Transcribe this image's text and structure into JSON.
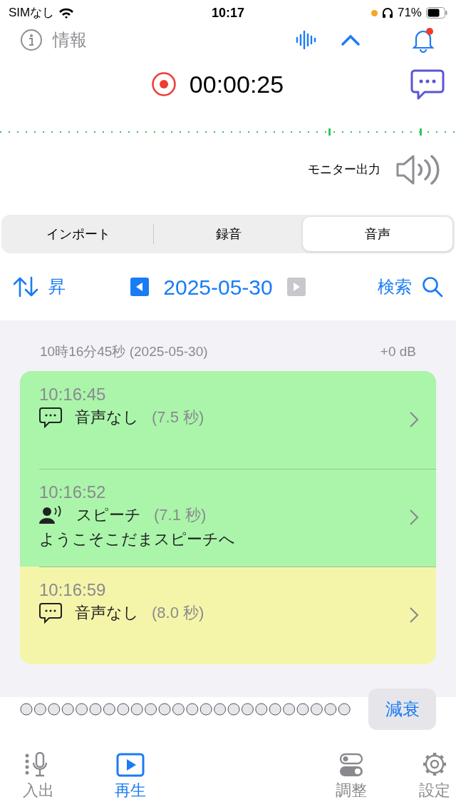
{
  "status_bar": {
    "carrier": "SIMなし",
    "time": "10:17",
    "battery": "71%"
  },
  "header": {
    "info_label": "情報"
  },
  "recorder": {
    "elapsed": "00:00:25",
    "monitor_label": "モニター出力"
  },
  "segments": [
    {
      "label": "インポート",
      "selected": false
    },
    {
      "label": "録音",
      "selected": false
    },
    {
      "label": "音声",
      "selected": true
    }
  ],
  "toolbar": {
    "sort_label": "昇",
    "date": "2025-05-30",
    "search_label": "検索"
  },
  "list_header": {
    "title": "10時16分45秒 (2025-05-30)",
    "gain": "+0 dB"
  },
  "entries": [
    {
      "kind": "silence",
      "time": "10:16:45",
      "label": "音声なし",
      "duration": "(7.5 秒)",
      "color": "#aaf5aa"
    },
    {
      "kind": "speech",
      "time": "10:16:52",
      "label": "スピーチ",
      "duration": "(7.1 秒)",
      "transcript": "ようこそこだまスピーチへ",
      "color": "#aaf5aa"
    },
    {
      "kind": "silence",
      "time": "10:16:59",
      "label": "音声なし",
      "duration": "(8.0 秒)",
      "color": "#f5f5aa"
    }
  ],
  "attenuate_button": "減衰",
  "tab_bar": [
    {
      "label": "入出",
      "kind": "mic",
      "selected": false
    },
    {
      "label": "再生",
      "kind": "play",
      "selected": true
    },
    {
      "label": "調整",
      "kind": "toggles",
      "selected": false
    },
    {
      "label": "設定",
      "kind": "gear",
      "selected": false
    }
  ]
}
